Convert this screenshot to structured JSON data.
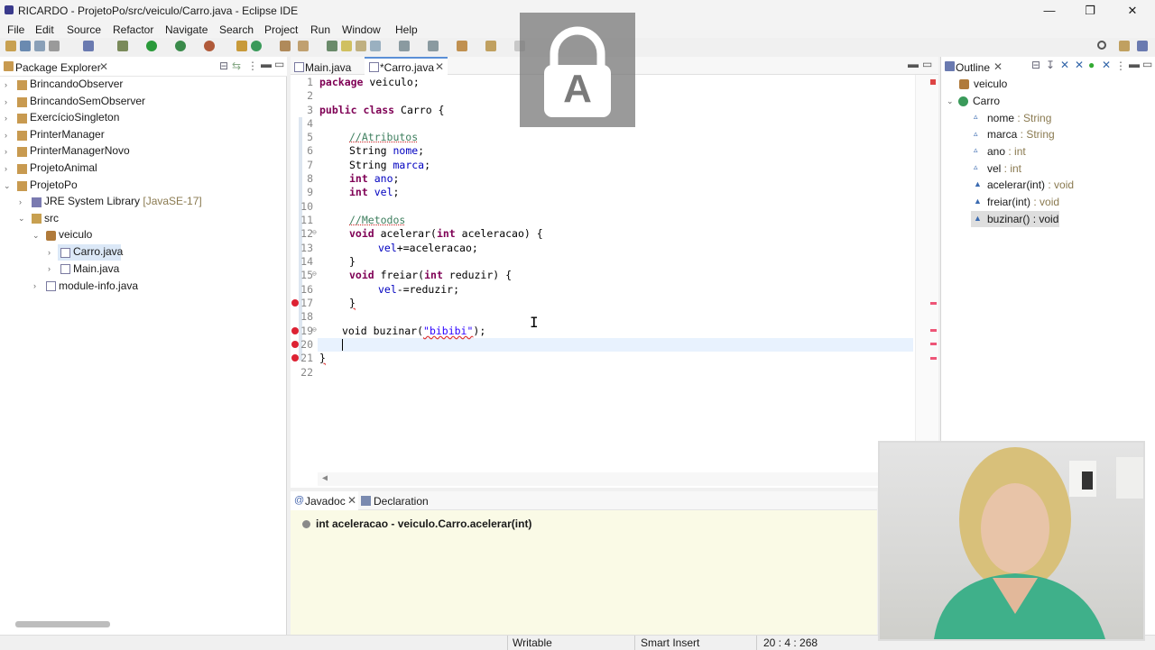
{
  "window": {
    "title": "RICARDO - ProjetoPo/src/veiculo/Carro.java - Eclipse IDE",
    "minimize": "—",
    "maximize": "❐",
    "close": "✕"
  },
  "menu": [
    "File",
    "Edit",
    "Source",
    "Refactor",
    "Navigate",
    "Search",
    "Project",
    "Run",
    "Window",
    "Help"
  ],
  "package_explorer": {
    "tab_label": "Package Explorer",
    "projects": [
      "BrincandoObserver",
      "BrincandoSemObserver",
      "ExercícioSingleton",
      "PrinterManager",
      "PrinterManagerNovo",
      "ProjetoAnimal",
      "ProjetoPo"
    ],
    "jre_label": "JRE System Library",
    "jre_version": "[JavaSE-17]",
    "src": "src",
    "package": "veiculo",
    "files": [
      "Carro.java",
      "Main.java"
    ],
    "module_info": "module-info.java"
  },
  "editor": {
    "tabs": [
      "Main.java",
      "*Carro.java"
    ],
    "line_numbers": [
      "1",
      "2",
      "3",
      "4",
      "5",
      "6",
      "7",
      "8",
      "9",
      "10",
      "11",
      "12",
      "13",
      "14",
      "15",
      "16",
      "17",
      "18",
      "19",
      "20",
      "21",
      "22"
    ]
  },
  "code": {
    "l1_kw": "package",
    "l1_rest": " veiculo;",
    "l3_kw": "public class",
    "l3_rest": " Carro {",
    "l5_comment": "//Atributos",
    "l6_type": "String ",
    "l6_field": "nome",
    "l7_type": "String ",
    "l7_field": "marca",
    "l8_kw": "int",
    "l8_field": "ano",
    "l9_kw": "int",
    "l9_field": "vel",
    "l11_comment": "//Metodos",
    "l12_kw": "void",
    "l12_mid": " acelerar(",
    "l12_kw2": "int",
    "l12_rest": " aceleracao) {",
    "l13_field": "vel",
    "l13_rest": "+=aceleracao;",
    "l14": "}",
    "l15_kw": "void",
    "l15_mid": " freiar(",
    "l15_kw2": "int",
    "l15_rest": " reduzir) {",
    "l16_field": "vel",
    "l16_rest": "-=reduzir;",
    "l17": "}",
    "l19_kw": "void",
    "l19_mid": " buzinar(",
    "l19_str": "\"bibibi\"",
    "l19_rest": ");",
    "l21": "}",
    "semicolon": ";"
  },
  "outline": {
    "tab_label": "Outline",
    "package": "veiculo",
    "class": "Carro",
    "members": [
      {
        "name": "nome",
        "type": " : String"
      },
      {
        "name": "marca",
        "type": " : String"
      },
      {
        "name": "ano",
        "type": " : int"
      },
      {
        "name": "vel",
        "type": " : int"
      },
      {
        "name": "acelerar(int)",
        "type": " : void"
      },
      {
        "name": "freiar(int)",
        "type": " : void"
      },
      {
        "name": "buzinar()",
        "type": " : void"
      }
    ]
  },
  "bottom_panel": {
    "tabs": [
      "Javadoc",
      "Declaration"
    ],
    "javadoc_text": "int aceleracao - veiculo.Carro.acelerar(int)"
  },
  "status": {
    "writable": "Writable",
    "insert_mode": "Smart Insert",
    "position": "20 : 4 : 268"
  },
  "lock_icon_letter": "A"
}
